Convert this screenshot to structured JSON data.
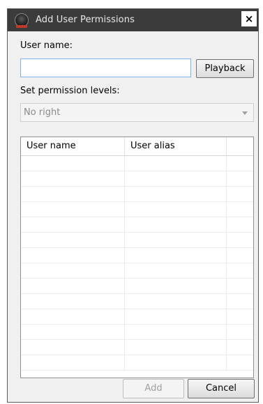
{
  "window": {
    "title": "Add User Permissions",
    "close_glyph": "×",
    "icon": "camera-app-icon"
  },
  "form": {
    "username_label": "User name:",
    "username_value": "",
    "playback_button": "Playback",
    "permission_label": "Set permission levels:",
    "permission_selected": "No right"
  },
  "table": {
    "columns": [
      "User name",
      "User alias",
      ""
    ],
    "rows": [
      [],
      [],
      [],
      [],
      [],
      [],
      [],
      [],
      [],
      [],
      [],
      [],
      [],
      []
    ]
  },
  "footer": {
    "add_button": "Add",
    "cancel_button": "Cancel"
  }
}
